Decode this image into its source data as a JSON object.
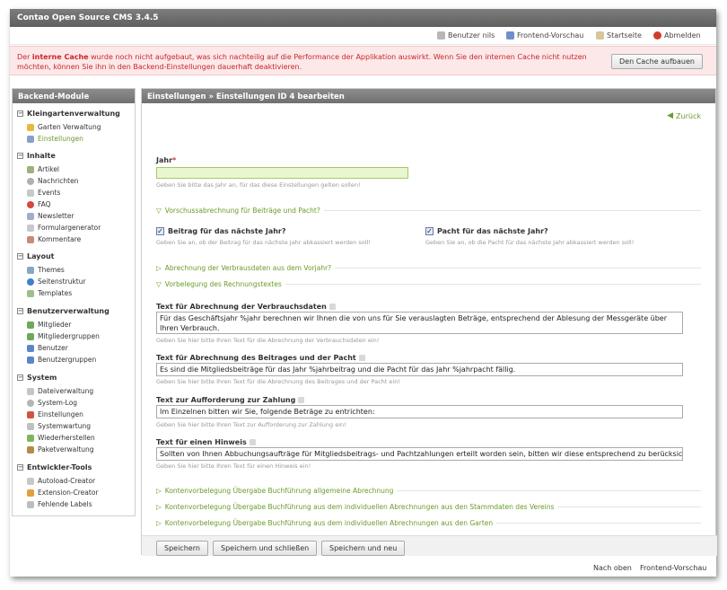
{
  "app": {
    "title": "Contao Open Source CMS 3.4.5"
  },
  "usernav": {
    "user": "Benutzer nils",
    "preview": "Frontend-Vorschau",
    "home": "Startseite",
    "logout": "Abmelden"
  },
  "notice": {
    "pre": "Der ",
    "strong": "interne Cache",
    "post": " wurde noch nicht aufgebaut, was sich nachteilig auf die Performance der Applikation auswirkt. Wenn Sie den internen Cache nicht nutzen möchten, können Sie ihn in den Backend-Einstellungen dauerhaft deaktivieren.",
    "button": "Den Cache aufbauen"
  },
  "sidebar": {
    "title": "Backend-Module",
    "groups": [
      {
        "label": "Kleingartenverwaltung",
        "items": [
          "Garten Verwaltung",
          "Einstellungen"
        ]
      },
      {
        "label": "Inhalte",
        "items": [
          "Artikel",
          "Nachrichten",
          "Events",
          "FAQ",
          "Newsletter",
          "Formulargenerator",
          "Kommentare"
        ]
      },
      {
        "label": "Layout",
        "items": [
          "Themes",
          "Seitenstruktur",
          "Templates"
        ]
      },
      {
        "label": "Benutzerverwaltung",
        "items": [
          "Mitglieder",
          "Mitgliedergruppen",
          "Benutzer",
          "Benutzergruppen"
        ]
      },
      {
        "label": "System",
        "items": [
          "Dateiverwaltung",
          "System-Log",
          "Einstellungen",
          "Systemwartung",
          "Wiederherstellen",
          "Paketverwaltung"
        ]
      },
      {
        "label": "Entwickler-Tools",
        "items": [
          "Autoload-Creator",
          "Extension-Creator",
          "Fehlende Labels"
        ]
      }
    ]
  },
  "main": {
    "title": "Einstellungen » Einstellungen ID 4 bearbeiten",
    "back": "Zurück",
    "jahr": {
      "label": "Jahr",
      "required": "*",
      "value": "",
      "help": "Geben Sie bitte das Jahr an, für das diese Einstellungen gelten sollen!"
    },
    "legend_vorschuss": "Vorschussabrechnung für Beiträge und Pacht?",
    "beitrag": {
      "label": "Beitrag für das nächste Jahr?",
      "help": "Geben Sie an, ob der Beitrag für das nächste Jahr abkassiert werden soll!"
    },
    "pacht": {
      "label": "Pacht für das nächste Jahr?",
      "help": "Geben Sie an, ob die Pacht für das nächste Jahr abkassiert werden soll!"
    },
    "legend_verbrauch": "Abrechnung der Verbrausdaten aus dem Vorjahr?",
    "legend_texte": "Vorbelegung des Rechnungstextes",
    "text1": {
      "label": "Text für Abrechnung der Verbrauchsdaten",
      "value": "Für das Geschäftsjahr %jahr berechnen wir Ihnen die von uns für Sie verauslagten Beträge, entsprechend der Ablesung der Messgeräte über Ihren Verbrauch.",
      "help": "Geben Sie hier bitte Ihren Text für die Abrechnung der Verbrauchsdaten ein!"
    },
    "text2": {
      "label": "Text für Abrechnung des Beitrages und der Pacht",
      "value": "Es sind die Mitgliedsbeiträge für das Jahr %jahrbeitrag und die Pacht für das Jahr %jahrpacht fällig.",
      "help": "Geben Sie hier bitte Ihren Text für die Abrechnung des Beitrages und der Pacht ein!"
    },
    "text3": {
      "label": "Text zur Aufforderung zur Zahlung",
      "value": "Im Einzelnen bitten wir Sie, folgende Beträge zu entrichten:",
      "help": "Geben Sie hier bitte Ihren Text zur Aufforderung zur Zahlung ein!"
    },
    "text4": {
      "label": "Text für einen Hinweis",
      "value": "Sollten von Ihnen Abbuchungsaufträge für Mitgliedsbeitrags- und Pachtzahlungen erteilt worden sein, bitten wir diese entsprechend zu berücksichtigen",
      "help": "Geben Sie hier bitte Ihren Text für einen Hinweis ein!"
    },
    "legend_k1": "Kontenvorbelegung Übergabe Buchführung allgemeine Abrechnung",
    "legend_k2": "Kontenvorbelegung Übergabe Buchführung aus dem individuellen Abrechnungen aus den Stammdaten des Vereins",
    "legend_k3": "Kontenvorbelegung Übergabe Buchführung aus dem individuellen Abrechnungen aus den Garten",
    "buttons": {
      "save": "Speichern",
      "save_close": "Speichern und schließen",
      "save_new": "Speichern und neu"
    }
  },
  "bottomnav": {
    "top": "Nach oben",
    "preview": "Frontend-Vorschau"
  }
}
